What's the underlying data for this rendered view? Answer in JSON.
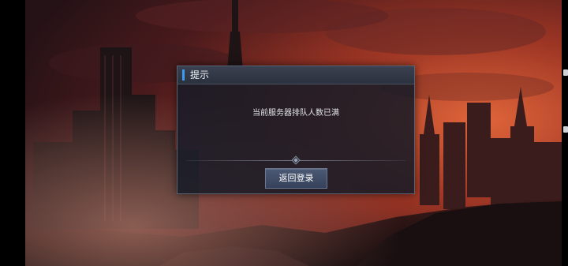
{
  "dialog": {
    "title": "提示",
    "message": "当前服务器排队人数已满",
    "button_label": "返回登录"
  },
  "colors": {
    "title_accent": "#3d9bf2",
    "sky_glow": "#d2522e",
    "dialog_bg": "#161b26",
    "button_bg": "#3f4b66"
  }
}
